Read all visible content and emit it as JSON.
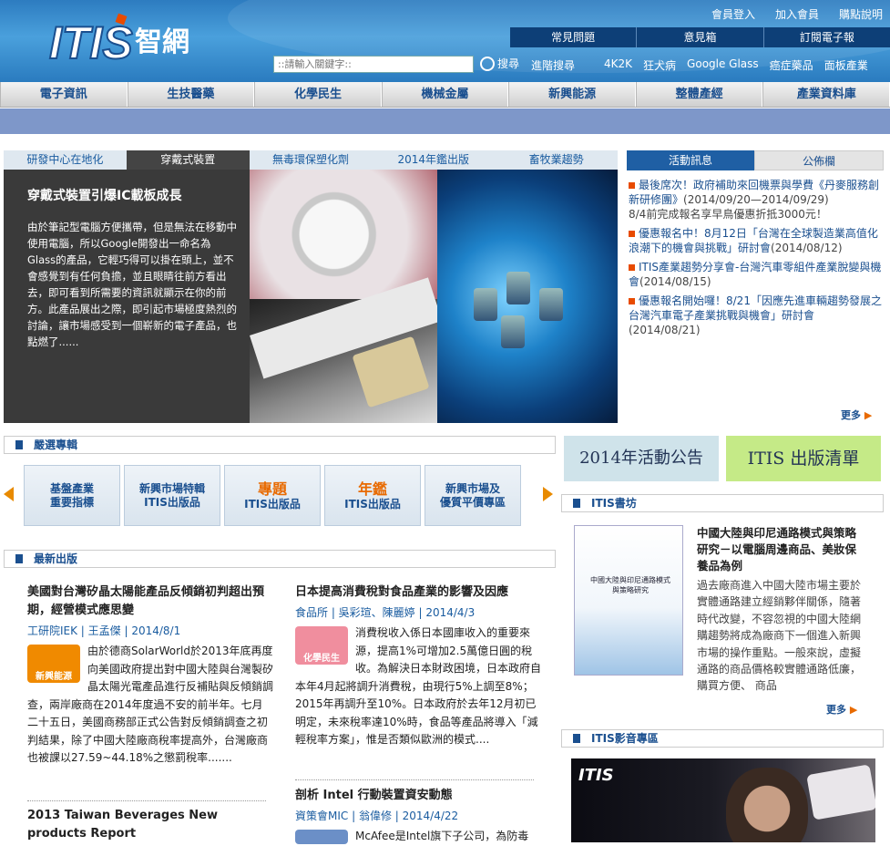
{
  "brand": {
    "logo_text": "ITIS",
    "logo_sub": "智網"
  },
  "toplinks": [
    "會員登入",
    "加入會員",
    "購點說明"
  ],
  "subnav": [
    "常見問題",
    "意見箱",
    "訂閱電子報"
  ],
  "search": {
    "placeholder": "::請輸入關鍵字::",
    "button": "搜尋",
    "advanced": "進階搜尋"
  },
  "hot_keywords": [
    "4K2K",
    "狂犬病",
    "Google Glass",
    "癌症藥品",
    "面板產業"
  ],
  "main_nav": [
    "電子資訊",
    "生技醫藥",
    "化學民生",
    "機械金屬",
    "新興能源",
    "整體產經",
    "產業資料庫"
  ],
  "feature": {
    "tabs": [
      "研發中心在地化",
      "穿戴式裝置",
      "無毒環保塑化劑",
      "2014年鑑出版",
      "畜牧業趨勢"
    ],
    "active_tab": 1,
    "title": "穿戴式裝置引爆IC載板成長",
    "body": "由於筆記型電腦方便攜帶，但是無法在移動中使用電腦，所以Google開發出一命名為Glass的產品，它輕巧得可以掛在頭上，並不會感覺到有任何負擔，並且眼睛往前方看出去，即可看到所需要的資訊就顯示在你的前方。此產品展出之際，即引起市場極度熱烈的討論，讓市場感受到一個嶄新的電子產品，也點燃了......"
  },
  "news_tabs": [
    "活動訊息",
    "公佈欄"
  ],
  "news": [
    {
      "text": "最後席次！政府補助來回機票與學費《丹麥服務創新研修團》",
      "date": "(2014/09/20—2014/09/29)",
      "extra": "8/4前完成報名享早鳥優惠折抵3000元！"
    },
    {
      "text": "優惠報名中！8月12日「台灣在全球製造業高值化浪潮下的機會與挑戰」研討會",
      "date": "(2014/08/12)",
      "extra": ""
    },
    {
      "text": "ITIS產業趨勢分享會-台灣汽車零組件產業脫變與機會",
      "date": "(2014/08/15)",
      "extra": ""
    },
    {
      "text": "優惠報名開始囉！8/21「因應先進車輛趨勢發展之台灣汽車電子產業挑戰與機會」研討會",
      "date": "(2014/08/21)",
      "extra": ""
    }
  ],
  "more_label": "更多",
  "sections": {
    "featured": "嚴選專輯",
    "latest": "最新出版",
    "bookshop": "ITIS書坊",
    "video": "ITIS影音專區"
  },
  "carousel": [
    {
      "line1": "基盤產業",
      "line2": "重要指標"
    },
    {
      "line1": "新興市場特輯",
      "line2": "ITIS出版品"
    },
    {
      "line1": "專題",
      "line2": "ITIS出版品"
    },
    {
      "line1": "年鑑",
      "line2": "ITIS出版品"
    },
    {
      "line1": "新興市場及",
      "line2": "優質平價專區"
    }
  ],
  "banners": {
    "activity": "2014年活動公告",
    "catalog": "ITIS 出版清單"
  },
  "publications": [
    {
      "title": "美國對台灣矽晶太陽能產品反傾銷初判超出預期，經營模式應思變",
      "meta": "工研院IEK | 王孟傑 | 2014/8/1",
      "thumb": "新興能源",
      "body": "由於德商SolarWorld於2013年底再度向美國政府提出對中國大陸與台灣製矽晶太陽光電產品進行反補貼與反傾銷調查，兩岸廠商在2014年度過不安的前半年。七月二十五日，美國商務部正式公告對反傾銷調查之初判結果，除了中國大陸廠商稅率提高外，台灣廠商也被課以27.59~44.18%之懲罰稅率......."
    },
    {
      "title": "日本提高消費稅對食品產業的影響及因應",
      "meta": "食品所 | 吳彩瑄、陳麗婷 | 2014/4/3",
      "thumb": "化學民生",
      "body": "消費稅收入係日本國庫收入的重要來源，提高1%可增加2.5萬億日圓的稅收。為解決日本財政困境，日本政府自本年4月起將調升消費稅，由現行5%上調至8%；2015年再調升至10%。日本政府於去年12月初已明定，未來稅率達10%時，食品等產品將導入「減輕稅率方案」，惟是否類似歐洲的模式...."
    },
    {
      "title": "2013 Taiwan Beverages New products Report",
      "meta": "",
      "thumb": "",
      "body": ""
    },
    {
      "title": "剖析 Intel 行動裝置資安動態",
      "meta": "資策會MIC | 翁偉修 | 2014/4/22",
      "thumb": "",
      "body": "McAfee是Intel旗下子公司，為防毒"
    }
  ],
  "book": {
    "title": "中國大陸與印尼通路模式與策略研究－以電腦周邊商品、美妝保養品為例",
    "body": "過去廠商進入中國大陸市場主要於實體通路建立經銷夥伴關係，隨著時代改變，不容忽視的中國大陸網購趨勢將成為廠商下一個進入新興市場的操作重點。一般來說，虛擬通路的商品價格較實體通路低廉，購買方便、 商品",
    "cover_title": "中國大陸與印尼通路模式與策略研究"
  },
  "video_logo": "ITIS",
  "colors": {
    "header": "#2d7cc0",
    "nav_text": "#1a4f8f",
    "accent": "#e84b00",
    "band": "#7e97c9"
  }
}
